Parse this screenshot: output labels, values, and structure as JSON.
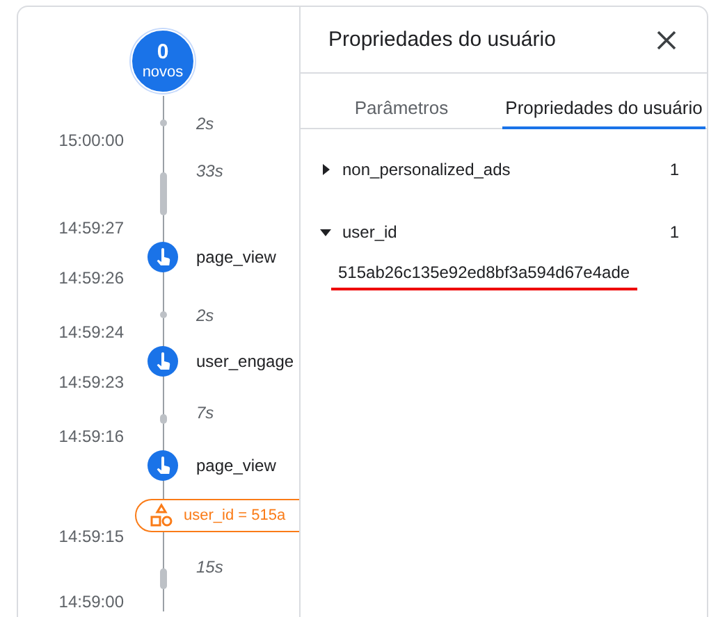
{
  "timeline": {
    "badge": {
      "count": "0",
      "label": "novos"
    },
    "entries": [
      {
        "kind": "dot-gap",
        "duration": "2s",
        "time": "15:00:00"
      },
      {
        "kind": "bar-gap",
        "duration": "33s",
        "time": "14:59:27"
      },
      {
        "kind": "event",
        "name": "page_view",
        "time": "14:59:26"
      },
      {
        "kind": "dot-gap",
        "duration": "2s",
        "time": "14:59:24"
      },
      {
        "kind": "event",
        "name": "user_engage",
        "time": "14:59:23"
      },
      {
        "kind": "bar-gap",
        "duration": "7s",
        "time": "14:59:16"
      },
      {
        "kind": "event",
        "name": "page_view"
      },
      {
        "kind": "property",
        "name": "user_id = 515a",
        "time": "14:59:15"
      },
      {
        "kind": "bar-gap",
        "duration": "15s",
        "time": "14:59:00"
      }
    ]
  },
  "panel": {
    "title": "Propriedades do usuário",
    "tabs": [
      {
        "label": "Parâmetros",
        "selected": false
      },
      {
        "label": "Propriedades do usuário",
        "selected": true
      }
    ],
    "properties": [
      {
        "name": "non_personalized_ads",
        "count": "1",
        "expanded": false
      },
      {
        "name": "user_id",
        "count": "1",
        "expanded": true,
        "value": "515ab26c135e92ed8bf3a594d67e4ade"
      }
    ]
  }
}
